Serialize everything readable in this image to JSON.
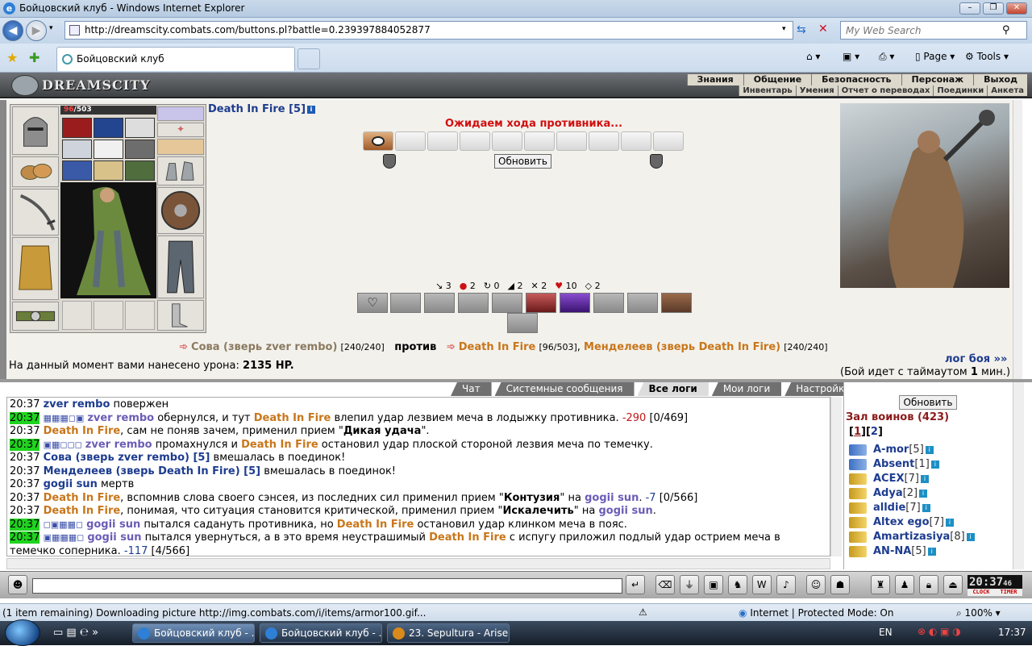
{
  "window": {
    "title": "Бойцовский клуб - Windows Internet Explorer",
    "address": "http://dreamscity.combats.com/buttons.pl?battle=0.239397884052877",
    "search_placeholder": "My Web Search",
    "tab_title": "Бойцовский клуб",
    "cmd_page": "Page",
    "cmd_tools": "Tools"
  },
  "site": {
    "logo": "DREAMSCITY",
    "menu_top": [
      "Знания",
      "Общение",
      "Безопасность",
      "Персонаж",
      "Выход"
    ],
    "menu_bottom": [
      "Инвентарь",
      "Умения",
      "Отчет о переводах",
      "Поединки",
      "Анкета"
    ]
  },
  "character": {
    "hp": "96",
    "hp_max": "/503",
    "name": "Death In Fire [5]"
  },
  "battle": {
    "waiting": "Ожидаем хода противника...",
    "refresh": "Обновить",
    "stats": [
      {
        "icon": "↘",
        "value": "3"
      },
      {
        "icon": "●",
        "value": "2"
      },
      {
        "icon": "↻",
        "value": "0"
      },
      {
        "icon": "◢",
        "value": "2"
      },
      {
        "icon": "✕",
        "value": "2"
      },
      {
        "icon": "♥",
        "value": "10"
      },
      {
        "icon": "◇",
        "value": "2"
      }
    ],
    "side1_name": "Сова (зверь zver rembo)",
    "side1_hp": "[240/240]",
    "versus": "против",
    "side2_name1": "Death In Fire",
    "side2_hp1": "[96/503]",
    "side2_name2": "Менделеев (зверь Death In Fire)",
    "side2_hp2": "[240/240]",
    "damage_label": "На данный момент вами нанесено урона:",
    "damage_value": "2135 HP.",
    "log_link": "лог боя »»",
    "timeout_pre": "(Бой идет с таймаутом ",
    "timeout_num": "1",
    "timeout_post": " мин.)"
  },
  "tabs": [
    "Чат",
    "Системные сообщения",
    "Все логи",
    "Мои логи",
    "Настройки"
  ],
  "log": [
    {
      "time": "20:37",
      "parts": [
        [
          "nb",
          "zver rembo"
        ],
        [
          "t",
          " повержен"
        ]
      ]
    },
    {
      "time": "20:37",
      "hl": true,
      "pre": "▦▦▦◻▣",
      "parts": [
        [
          "np",
          "zver rembo"
        ],
        [
          "t",
          " обернулся, и тут "
        ],
        [
          "fire",
          "Death In Fire"
        ],
        [
          "t",
          " влепил удар лезвием меча в лодыжку противника. "
        ],
        [
          "red",
          "-290"
        ],
        [
          "t",
          " [0/469]"
        ]
      ]
    },
    {
      "time": "20:37",
      "parts": [
        [
          "fire",
          "Death In Fire"
        ],
        [
          "t",
          ", сам не поняв зачем, применил прием \""
        ],
        [
          "b",
          "Дикая удача"
        ],
        [
          "t",
          "\"."
        ]
      ]
    },
    {
      "time": "20:37",
      "hl": true,
      "pre": "▣▦◻◻◻",
      "parts": [
        [
          "np",
          "zver rembo"
        ],
        [
          "t",
          " промахнулся и "
        ],
        [
          "fire",
          "Death In Fire"
        ],
        [
          "t",
          " остановил удар плоской стороной лезвия меча по темечку."
        ]
      ]
    },
    {
      "time": "20:37",
      "parts": [
        [
          "nb",
          "Сова (зверь zver rembo) [5]"
        ],
        [
          "t",
          " вмешалась в поединок!"
        ]
      ]
    },
    {
      "time": "20:37",
      "parts": [
        [
          "nb",
          "Менделеев (зверь Death In Fire) [5]"
        ],
        [
          "t",
          " вмешалась в поединок!"
        ]
      ]
    },
    {
      "time": "20:37",
      "parts": [
        [
          "nb",
          "gogii sun"
        ],
        [
          "t",
          " мертв"
        ]
      ]
    },
    {
      "time": "20:37",
      "parts": [
        [
          "fire",
          "Death In Fire"
        ],
        [
          "t",
          ", вспомнив слова своего сэнсея, из последних сил применил прием \""
        ],
        [
          "b",
          "Контузия"
        ],
        [
          "t",
          "\" на "
        ],
        [
          "np",
          "gogii sun"
        ],
        [
          "t",
          ". "
        ],
        [
          "blu",
          "-7"
        ],
        [
          "t",
          " [0/566]"
        ]
      ]
    },
    {
      "time": "20:37",
      "parts": [
        [
          "fire",
          "Death In Fire"
        ],
        [
          "t",
          ", понимая, что ситуация становится критической, применил прием \""
        ],
        [
          "b",
          "Искалечить"
        ],
        [
          "t",
          "\" на "
        ],
        [
          "np",
          "gogii sun"
        ],
        [
          "t",
          "."
        ]
      ]
    },
    {
      "time": "20:37",
      "hl": true,
      "pre": "◻▣▦▦◻",
      "parts": [
        [
          "np",
          "gogii sun"
        ],
        [
          "t",
          " пытался садануть противника, но "
        ],
        [
          "fire",
          "Death In Fire"
        ],
        [
          "t",
          " остановил удар клинком меча в пояс."
        ]
      ]
    },
    {
      "time": "20:37",
      "hl": true,
      "pre": "▣▦▦▦◻",
      "parts": [
        [
          "np",
          "gogii sun"
        ],
        [
          "t",
          " пытался увернуться, а в это время неустрашимый "
        ],
        [
          "fire",
          "Death In Fire"
        ],
        [
          "t",
          " с испугу приложил подлый удар острием меча в"
        ]
      ]
    },
    {
      "time": "",
      "parts": [
        [
          "t",
          "темечко соперника. "
        ],
        [
          "blu",
          "-117"
        ],
        [
          "t",
          " [4/566]"
        ]
      ]
    }
  ],
  "hall": {
    "refresh": "Обновить",
    "title": "Зал воинов (423)",
    "pages_open": "[",
    "page1": "1",
    "pages_mid": "][",
    "page2": "2",
    "pages_close": "]",
    "players": [
      {
        "name": "A-mor",
        "level": "[5]",
        "color": "blue"
      },
      {
        "name": "Absent",
        "level": "[1]",
        "color": "blue"
      },
      {
        "name": "ACEX",
        "level": "[7]",
        "color": "yellow"
      },
      {
        "name": "Adya",
        "level": "[2]",
        "color": "yellow"
      },
      {
        "name": "alldie",
        "level": "[7]",
        "color": "yellow"
      },
      {
        "name": "Altex ego",
        "level": "[7]",
        "color": "yellow"
      },
      {
        "name": "Amartizasiya",
        "level": "[8]",
        "color": "yellow"
      },
      {
        "name": "AN-NA",
        "level": "[5]",
        "color": "yellow"
      }
    ]
  },
  "clock": {
    "time": "20:37",
    "seconds": "46",
    "label1": "CLOCK",
    "label2": "TIMER"
  },
  "statusbar": {
    "text": "(1 item remaining) Downloading picture http://img.combats.com/i/items/armor100.gif...",
    "zone": "Internet | Protected Mode: On",
    "zoom": "100%"
  },
  "taskbar": {
    "tasks": [
      "Бойцовский клуб - ...",
      "Бойцовский клуб - ...",
      "23. Sepultura - Arise..."
    ],
    "lang": "EN",
    "time": "17:37"
  }
}
